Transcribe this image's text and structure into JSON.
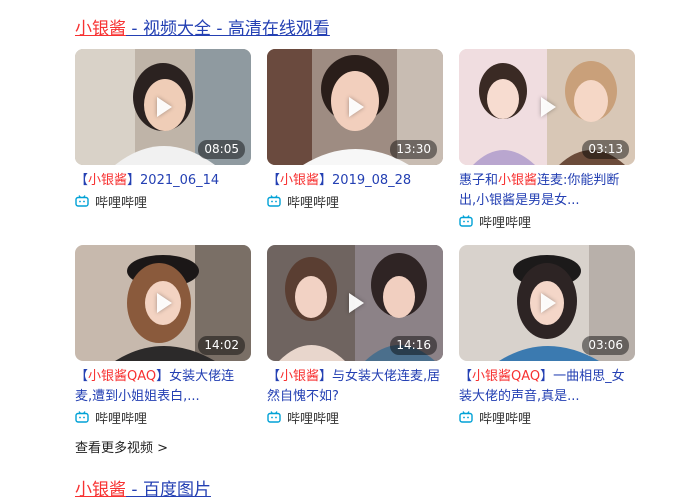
{
  "header": {
    "highlight": "小银酱",
    "rest": " - 视频大全 - 高清在线观看"
  },
  "videos": [
    {
      "title_pre": "【",
      "title_hl": "小银酱",
      "title_post": "】2021_06_14",
      "duration": "08:05",
      "source": "哔哩哔哩"
    },
    {
      "title_pre": "【",
      "title_hl": "小银酱",
      "title_post": "】2019_08_28",
      "duration": "13:30",
      "source": "哔哩哔哩"
    },
    {
      "title_pre": "惠子和",
      "title_hl": "小银酱",
      "title_post": "连麦:你能判断出,小银酱是男是女...",
      "duration": "03:13",
      "source": "哔哩哔哩"
    },
    {
      "title_pre": "【",
      "title_hl": "小银酱QAQ",
      "title_post": "】女装大佬连麦,遭到小姐姐表白,...",
      "duration": "14:02",
      "source": "哔哩哔哩"
    },
    {
      "title_pre": "【",
      "title_hl": "小银酱",
      "title_post": "】与女装大佬连麦,居然自愧不如?",
      "duration": "14:16",
      "source": "哔哩哔哩"
    },
    {
      "title_pre": "【",
      "title_hl": "小银酱QAQ",
      "title_post": "】一曲相思_女装大佬的声音,真是...",
      "duration": "03:06",
      "source": "哔哩哔哩"
    }
  ],
  "more_link": "查看更多视频 >",
  "next_section": {
    "highlight": "小银酱",
    "rest": " - 百度图片"
  },
  "colors": {
    "link": "#2440b3",
    "highlight": "#f73131",
    "bilibili": "#00a1d6"
  }
}
